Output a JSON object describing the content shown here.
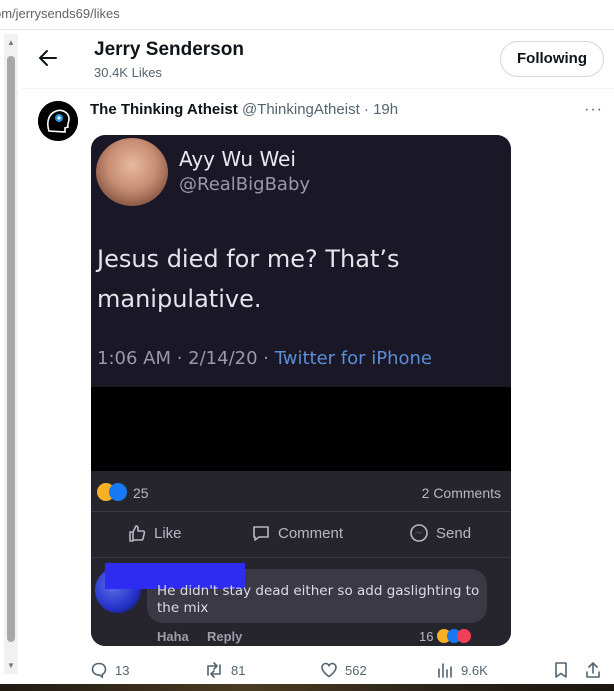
{
  "url": "om/jerrysends69/likes",
  "header": {
    "name": "Jerry Senderson",
    "likes_count": "30.4K Likes",
    "follow_label": "Following"
  },
  "tweet": {
    "author_name": "The Thinking Atheist",
    "author_handle": "@ThinkingAtheist",
    "separator": "·",
    "time": "19h",
    "more": "···",
    "media": {
      "name": "Ayy Wu Wei",
      "handle": "@RealBigBaby",
      "text": "Jesus died for me? That’s manipulative.",
      "time": "1:06 AM · 2/14/20 ·",
      "client": "Twitter for iPhone",
      "fb_reactions_count": "25",
      "fb_comments": "2 Comments",
      "fb_like": "Like",
      "fb_comment": "Comment",
      "fb_send": "Send",
      "comment_text": "He didn't stay dead either so add gaslighting to the mix",
      "comment_haha": "Haha",
      "comment_reply": "Reply",
      "comment_reactions": "16"
    },
    "actions": {
      "replies": "13",
      "retweets": "81",
      "likes": "562",
      "views": "9.6K"
    }
  },
  "colors": {
    "accent": "#1d9bf0",
    "text_secondary": "#536471",
    "media_bg": "#1a1726"
  }
}
